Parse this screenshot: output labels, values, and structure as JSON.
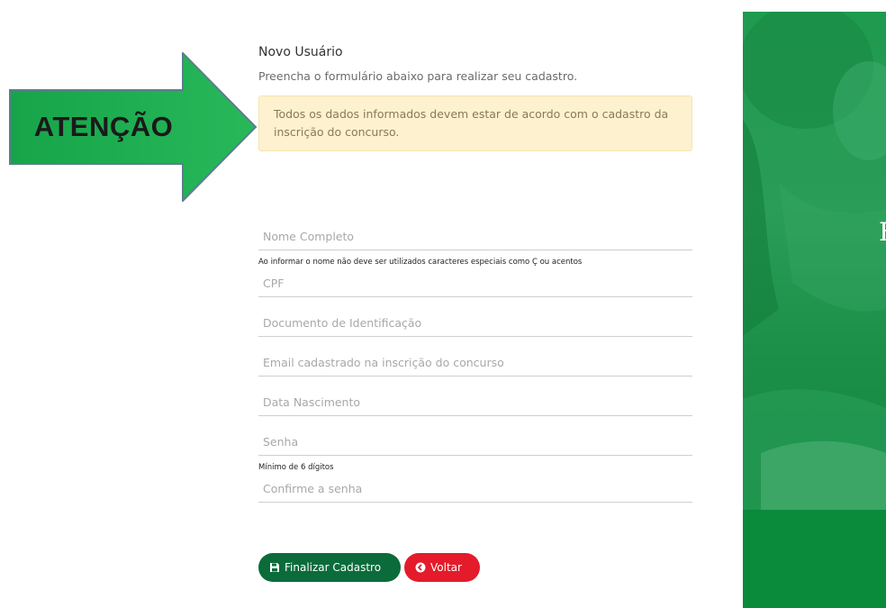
{
  "annotation": {
    "label": "ATENÇÃO"
  },
  "form": {
    "title": "Novo Usuário",
    "subtitle": "Preencha o formulário abaixo para realizar seu cadastro.",
    "alert": "Todos os dados informados devem estar de acordo com o cadastro da inscrição do concurso.",
    "fields": {
      "nome_placeholder": "Nome Completo",
      "nome_hint": "Ao informar o nome não deve ser utilizados caracteres especiais como Ç ou acentos",
      "cpf_placeholder": "CPF",
      "documento_placeholder": "Documento de Identificação",
      "email_placeholder": "Email cadastrado na inscrição do concurso",
      "nascimento_placeholder": "Data Nascimento",
      "senha_placeholder": "Senha",
      "senha_hint": "Mínimo de 6 dígitos",
      "confirma_placeholder": "Confirme a senha"
    },
    "buttons": {
      "finalizar_label": "Finalizar Cadastro",
      "finalizar_icon": "save-icon",
      "voltar_label": "Voltar",
      "voltar_icon": "circle-chevron-left-icon"
    }
  },
  "panel": {
    "partial_letter": "F"
  },
  "colors": {
    "primary_green": "#0b6b3a",
    "danger_red": "#e31b2a",
    "panel_green": "#0a8a3b",
    "arrow_green": "#1ea84e",
    "alert_bg": "#fdf1cf"
  }
}
